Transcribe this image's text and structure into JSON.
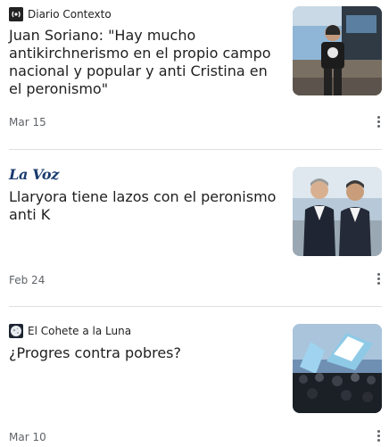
{
  "articles": [
    {
      "source": "Diario Contexto",
      "source_icon": "broadcast-icon",
      "headline": "Juan Soriano: \"Hay mucho antikirchnerismo en el propio campo nacional y popular y anti Cristina en el peronismo\"",
      "date": "Mar 15",
      "thumb_desc": "man-standing-photo"
    },
    {
      "source": "La Voz",
      "source_icon": "la-voz-logo",
      "headline": "Llaryora tiene lazos con el peronismo anti K",
      "date": "Feb 24",
      "thumb_desc": "two-men-photo"
    },
    {
      "source": "El Cohete a la Luna",
      "source_icon": "moon-icon",
      "headline": "¿Progres contra pobres?",
      "date": "Mar 10",
      "thumb_desc": "crowd-flags-photo"
    }
  ],
  "colors": {
    "text": "#1f1f1f",
    "muted": "#5f6368",
    "divider": "#e0e0e0",
    "lavoz": "#1a3c6e"
  },
  "more_icon": "more-vert-icon"
}
